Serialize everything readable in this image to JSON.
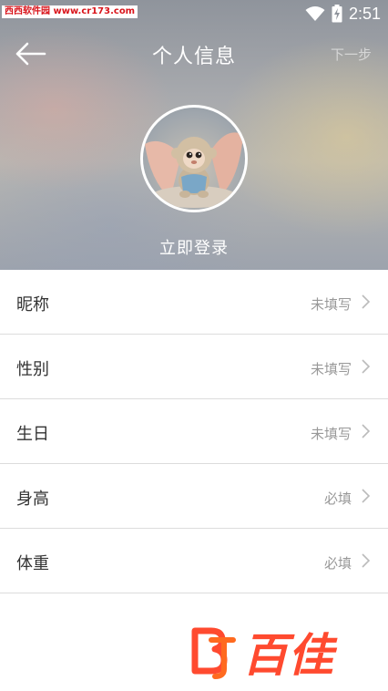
{
  "status_bar": {
    "watermark": "西西软件园 www.cr173.com",
    "time": "2:51"
  },
  "header": {
    "title": "个人信息",
    "next_label": "下一步",
    "login_label": "立即登录"
  },
  "rows": [
    {
      "label": "昵称",
      "value": "未填写"
    },
    {
      "label": "性别",
      "value": "未填写"
    },
    {
      "label": "生日",
      "value": "未填写"
    },
    {
      "label": "身高",
      "value": "必填"
    },
    {
      "label": "体重",
      "value": "必填"
    }
  ],
  "brand": {
    "text": "百佳",
    "color": "#ff4a2f"
  },
  "icons": [
    "back-arrow-icon",
    "wifi-icon",
    "battery-icon",
    "chevron-right-icon",
    "avatar-monkey",
    "brand-logo"
  ]
}
